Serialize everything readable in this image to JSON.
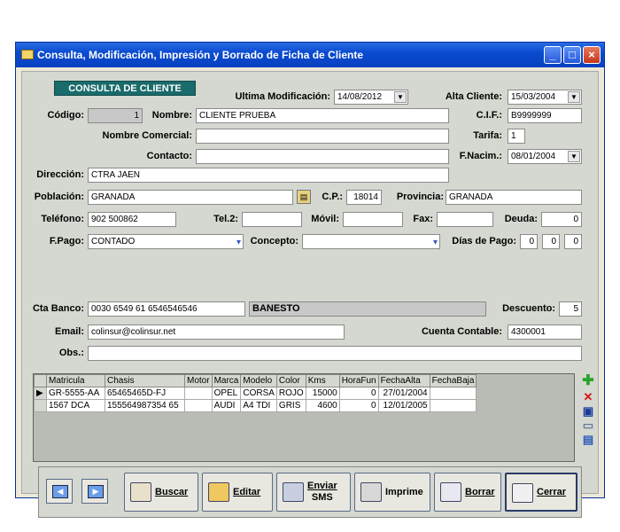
{
  "window": {
    "title": "Consulta, Modificación, Impresión y Borrado de Ficha de Cliente"
  },
  "header": {
    "badge": "CONSULTA DE CLIENTE"
  },
  "labels": {
    "ultima_mod": "Ultima Modificación:",
    "alta_cliente": "Alta Cliente:",
    "codigo": "Código:",
    "nombre": "Nombre:",
    "cif": "C.I.F.:",
    "nombre_comercial": "Nombre Comercial:",
    "tarifa": "Tarifa:",
    "contacto": "Contacto:",
    "fnacim": "F.Nacim.:",
    "direccion": "Dirección:",
    "poblacion": "Población:",
    "cp": "C.P.:",
    "provincia": "Provincia:",
    "telefono": "Teléfono:",
    "tel2": "Tel.2:",
    "movil": "Móvil:",
    "fax": "Fax:",
    "deuda": "Deuda:",
    "fpago": "F.Pago:",
    "concepto": "Concepto:",
    "dias_pago": "Días de Pago:",
    "cta_banco": "Cta Banco:",
    "descuento": "Descuento:",
    "email": "Email:",
    "cuenta_contable": "Cuenta Contable:",
    "obs": "Obs.:"
  },
  "values": {
    "ultima_mod": "14/08/2012",
    "alta_cliente": "15/03/2004",
    "codigo": "1",
    "nombre": "CLIENTE PRUEBA",
    "cif": "B9999999",
    "nombre_comercial": "",
    "tarifa": "1",
    "contacto": "",
    "fnacim": "08/01/2004",
    "direccion": "CTRA JAEN",
    "poblacion": "GRANADA",
    "cp": "18014",
    "provincia": "GRANADA",
    "telefono": "902 500862",
    "tel2": "",
    "movil": "",
    "fax": "",
    "deuda": "0",
    "fpago": "CONTADO",
    "concepto": "",
    "dias_pago_1": "0",
    "dias_pago_2": "0",
    "dias_pago_3": "0",
    "cta_banco": "0030 6549 61 6546546546",
    "banco_nombre": "BANESTO",
    "descuento": "5",
    "email": "colinsur@colinsur.net",
    "cuenta_contable": "4300001",
    "obs": ""
  },
  "vehicles": {
    "columns": [
      "Matricula",
      "Chasis",
      "Motor",
      "Marca",
      "Modelo",
      "Color",
      "Kms",
      "HoraFun",
      "FechaAlta",
      "FechaBaja"
    ],
    "rows": [
      [
        "GR-5555-AA",
        "65465465D-FJ",
        "",
        "OPEL",
        "CORSA",
        "ROJO",
        "15000",
        "0",
        "27/01/2004",
        ""
      ],
      [
        "1567 DCA",
        "155564987354 65",
        "",
        "AUDI",
        "A4 TDI",
        "GRIS",
        "4600",
        "0",
        "12/01/2005",
        ""
      ]
    ]
  },
  "toolbar": {
    "buscar": "Buscar",
    "editar": "Editar",
    "enviar_sms_1": "Enviar",
    "enviar_sms_2": "SMS",
    "imprime": "Imprime",
    "borrar": "Borrar",
    "cerrar": "Cerrar"
  },
  "colors": {
    "header_badge": "#1a6b6b",
    "titlebar": "#0a4bd0"
  }
}
